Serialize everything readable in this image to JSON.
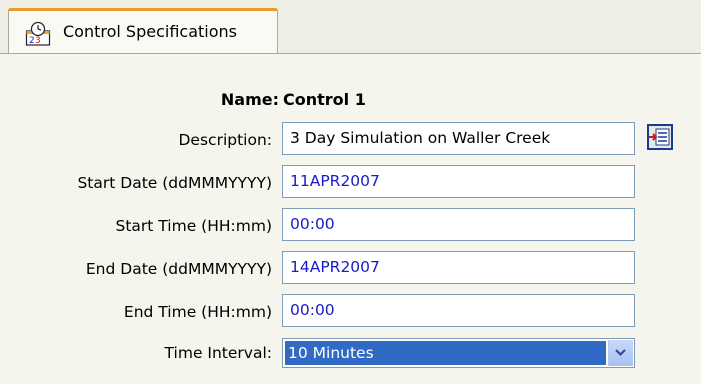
{
  "tab": {
    "label": "Control Specifications",
    "icon": "calendar-clock-icon",
    "accent": "#e89a2c"
  },
  "form": {
    "name_label": "Name:",
    "name_value": "Control 1",
    "description_label": "Description:",
    "description_value": "3 Day Simulation on Waller Creek",
    "start_date_label": "Start Date (ddMMMYYYY)",
    "start_date_value": "11APR2007",
    "start_time_label": "Start Time (HH:mm)",
    "start_time_value": "00:00",
    "end_date_label": "End Date (ddMMMYYYY)",
    "end_date_value": "14APR2007",
    "end_time_label": "End Time (HH:mm)",
    "end_time_value": "00:00",
    "time_interval_label": "Time Interval:",
    "time_interval_value": "10 Minutes"
  },
  "colors": {
    "value_text": "#1a1ac8",
    "selection": "#316ac5"
  }
}
